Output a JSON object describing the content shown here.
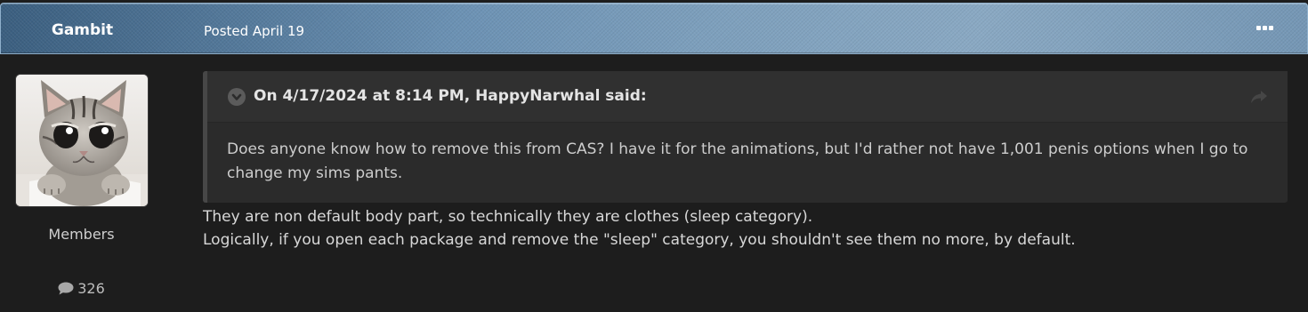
{
  "post": {
    "author": "Gambit",
    "date": "Posted April 19",
    "member_group": "Members",
    "post_count": "326",
    "icons": {
      "menu": "more-options-icon",
      "comment": "comment-bubble-icon",
      "quote_toggle": "chevron-down-icon",
      "quote_share": "share-arrow-icon"
    },
    "quote": {
      "citation": "On 4/17/2024 at 8:14 PM, HappyNarwhal said:",
      "text": "Does anyone know how to remove this from CAS? I have it for the animations, but I'd rather not have 1,001 penis options when I go to change my sims pants."
    },
    "body": [
      "They are non default body part, so technically they are clothes (sleep category).",
      "Logically, if you open each package and remove the \"sleep\" category, you shouldn't see them no more, by default."
    ]
  },
  "colors": {
    "header_accent": "#6c92b4",
    "background": "#1d1d1d",
    "quote_background": "#2b2b2b"
  }
}
